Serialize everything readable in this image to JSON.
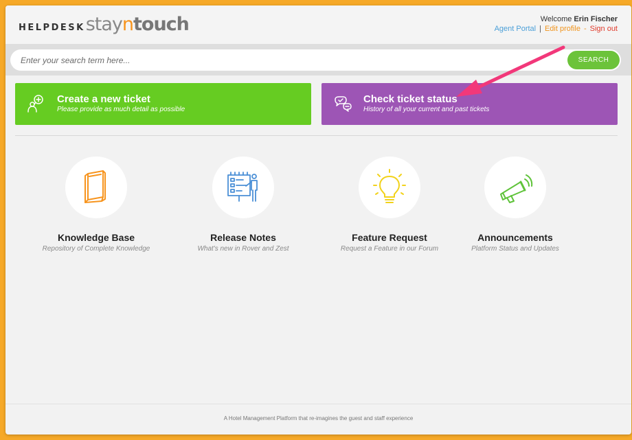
{
  "header": {
    "logo": {
      "helpdesk": "HELPDESK",
      "stay": "stay",
      "n": "n",
      "touch": "touch"
    },
    "welcome_prefix": "Welcome",
    "user_name": "Erin Fischer",
    "agent_portal": "Agent Portal",
    "separator": "|",
    "edit_profile": "Edit profile",
    "separator2": "-",
    "sign_out": "Sign out"
  },
  "search": {
    "placeholder": "Enter your search term here...",
    "button": "SEARCH"
  },
  "actions": [
    {
      "title": "Create a new ticket",
      "subtitle": "Please provide as much detail as possible",
      "icon": "new-ticket-icon",
      "color": "#66cc22"
    },
    {
      "title": "Check ticket status",
      "subtitle": "History of all your current and past tickets",
      "icon": "ticket-status-icon",
      "color": "#9d55b5"
    }
  ],
  "cards": [
    {
      "title": "Knowledge Base",
      "subtitle": "Repository of Complete Knowledge",
      "icon": "book-icon"
    },
    {
      "title": "Release Notes",
      "subtitle": "What's new in Rover and Zest",
      "icon": "presentation-board-icon"
    },
    {
      "title": "Feature Request",
      "subtitle": "Request a Feature in our Forum",
      "icon": "lightbulb-icon"
    },
    {
      "title": "Announcements",
      "subtitle": "Platform Status and Updates",
      "icon": "megaphone-icon"
    }
  ],
  "footer": {
    "text": "A Hotel Management Platform that re-imagines the guest and staff experience"
  },
  "colors": {
    "accent_orange": "#f7941d",
    "background": "#f6a928",
    "annotation_arrow": "#f2387a"
  }
}
